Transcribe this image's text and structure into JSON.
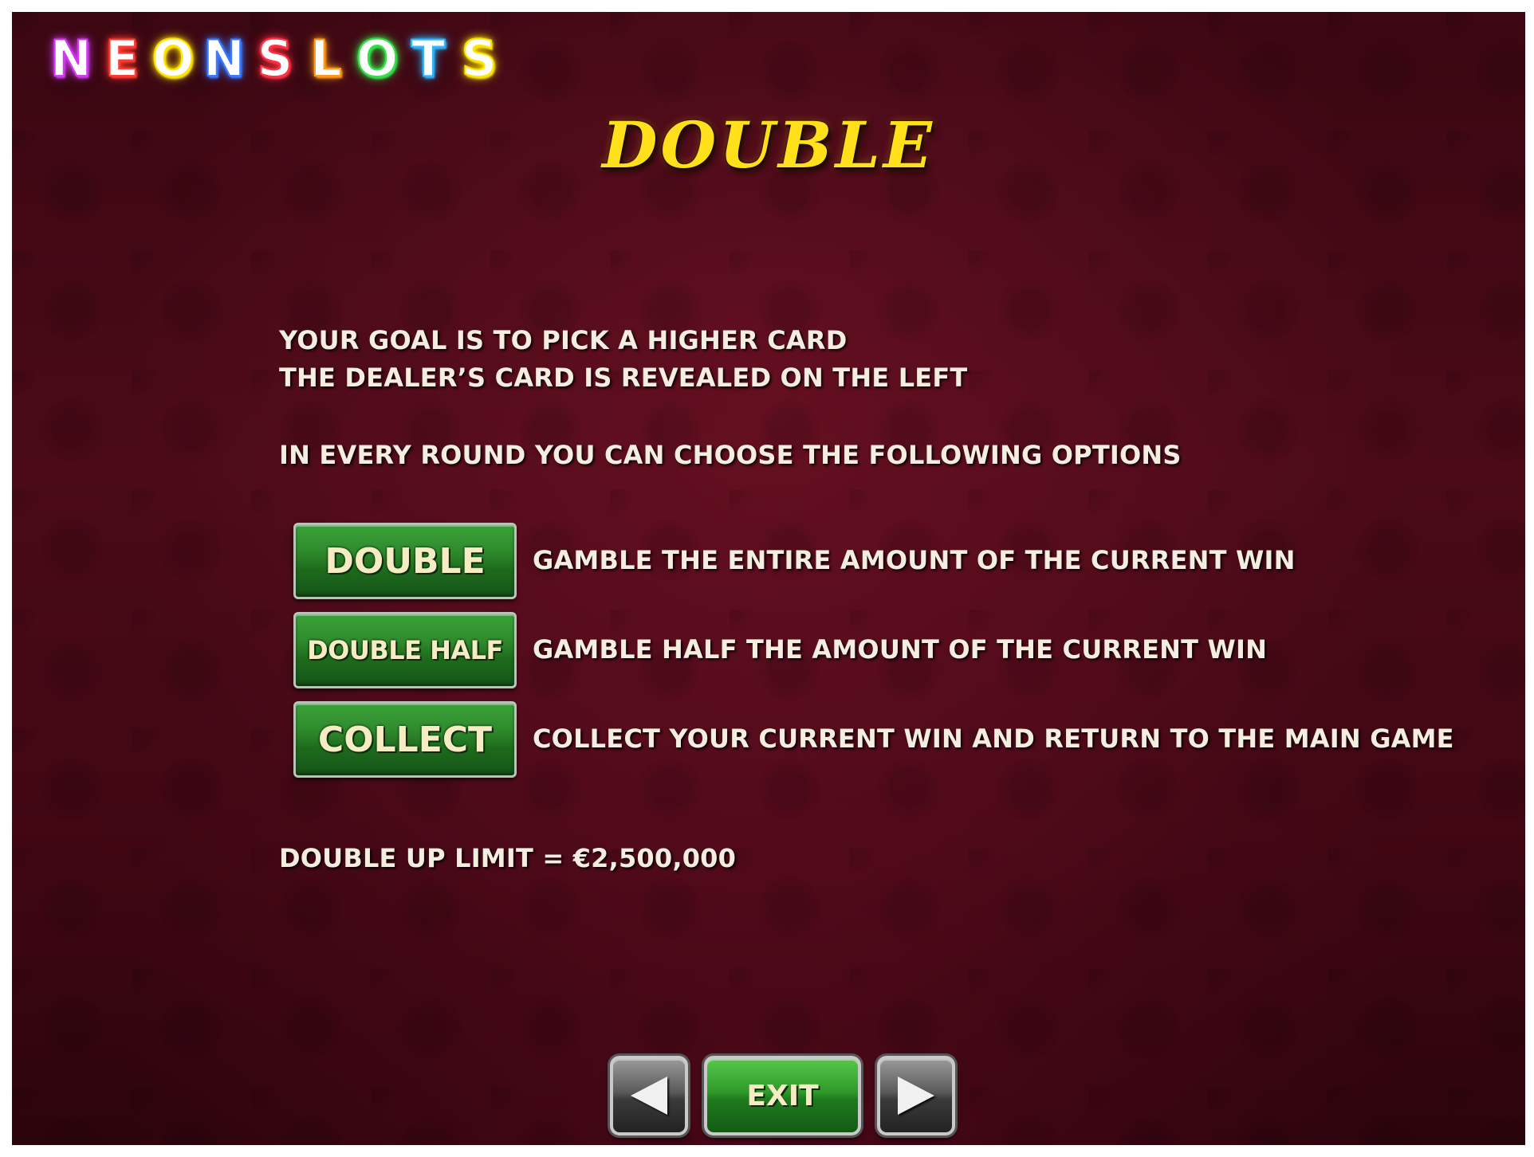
{
  "logo": {
    "letters": [
      {
        "char": "N",
        "color": "#d23cf0"
      },
      {
        "char": "E",
        "color": "#ff3b2f"
      },
      {
        "char": "O",
        "color": "#ffe600"
      },
      {
        "char": "N",
        "color": "#3a7bff"
      },
      {
        "char": "S",
        "color": "#ff3344"
      },
      {
        "char": "L",
        "color": "#ff9a1a"
      },
      {
        "char": "O",
        "color": "#35e04a"
      },
      {
        "char": "T",
        "color": "#2fb6ff"
      },
      {
        "char": "S",
        "color": "#ffe600"
      }
    ]
  },
  "title": "DOUBLE",
  "intro": {
    "line1": "YOUR GOAL IS TO PICK A HIGHER CARD",
    "line2": "THE DEALER’S CARD IS REVEALED ON THE LEFT",
    "line3": "IN EVERY ROUND YOU CAN CHOOSE THE FOLLOWING OPTIONS"
  },
  "options": {
    "double": {
      "label": "DOUBLE",
      "description": "GAMBLE THE ENTIRE AMOUNT OF THE CURRENT WIN"
    },
    "double_half": {
      "label": "DOUBLE HALF",
      "description": "GAMBLE HALF THE AMOUNT OF THE CURRENT WIN"
    },
    "collect": {
      "label": "COLLECT",
      "description": "COLLECT YOUR CURRENT WIN AND RETURN TO THE MAIN GAME"
    }
  },
  "limit_text": "DOUBLE UP LIMIT = €2,500,000",
  "nav": {
    "prev_icon": "arrow-left-icon",
    "exit_label": "EXIT",
    "next_icon": "arrow-right-icon"
  },
  "colors": {
    "title": "#ffe01a",
    "button_green": "#2f8a2c",
    "background": "#3f0713"
  }
}
